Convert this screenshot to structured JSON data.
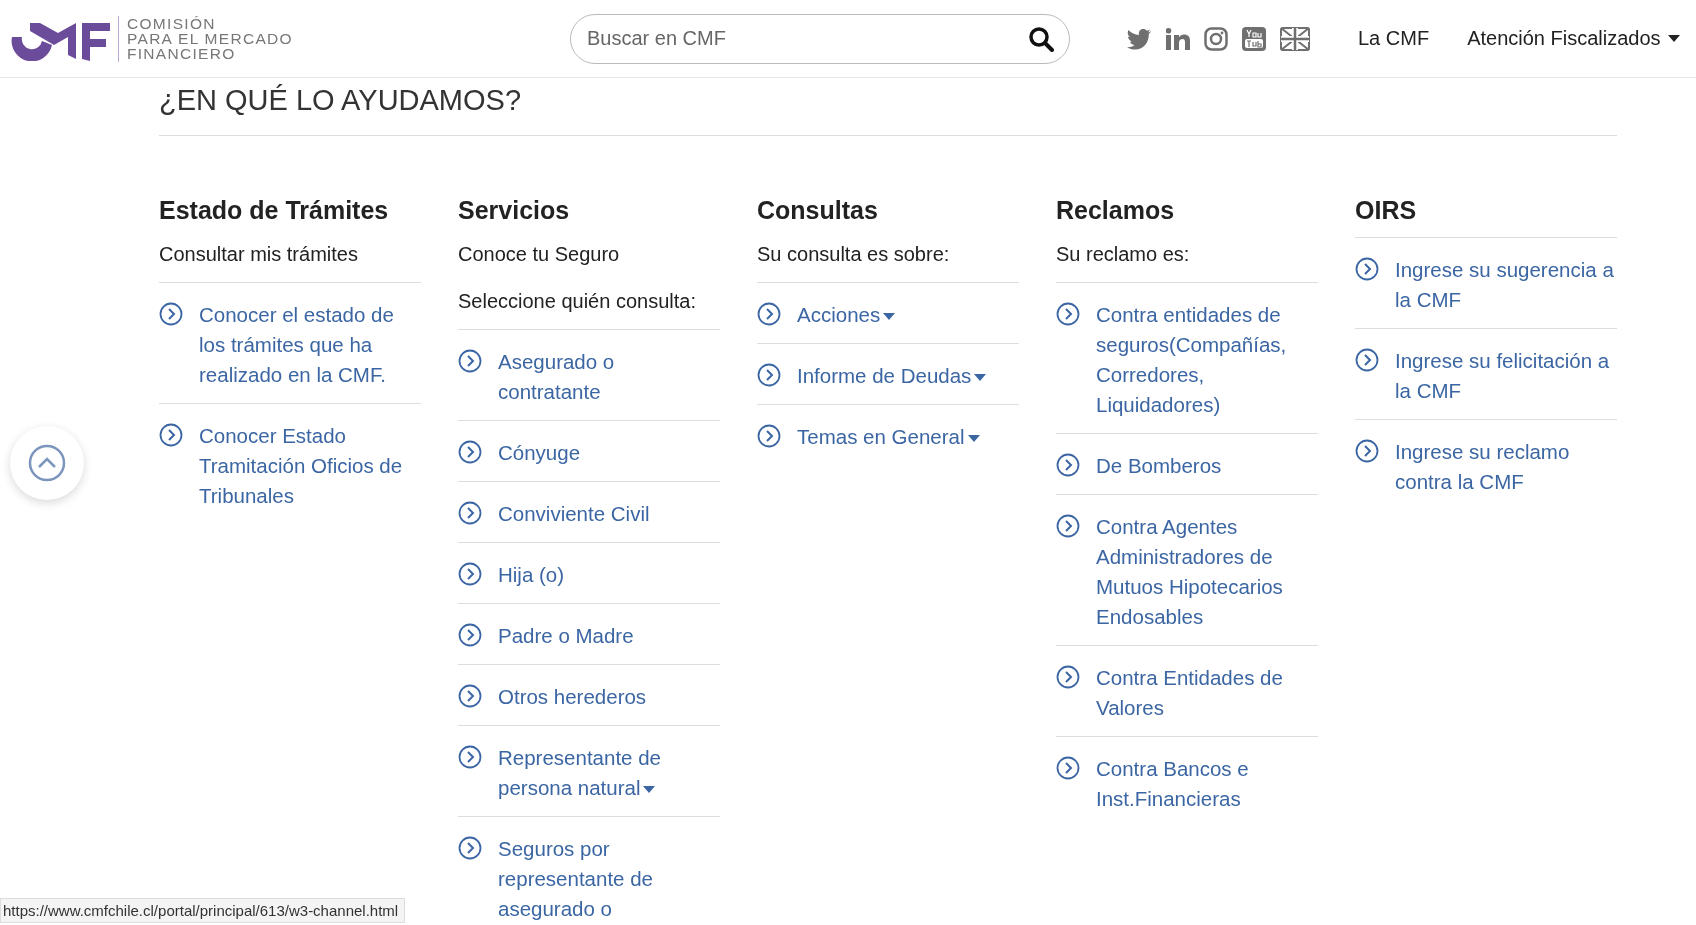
{
  "header": {
    "logo_text": [
      "COMISIÓN",
      "PARA EL MERCADO",
      "FINANCIERO"
    ],
    "search": {
      "placeholder": "Buscar en CMF"
    },
    "nav": [
      {
        "label": "La CMF",
        "dropdown": false
      },
      {
        "label": "Atención Fiscalizados",
        "dropdown": true
      }
    ]
  },
  "title": "¿EN QUÉ LO AYUDAMOS?",
  "columns": [
    {
      "title": "Estado de Trámites",
      "subtitles": [
        "Consultar mis trámites"
      ],
      "links": [
        {
          "label": "Conocer el estado de los trámites que ha realizado en la CMF.",
          "dropdown": false
        },
        {
          "label": "Conocer Estado Tramitación Oficios de Tribunales",
          "dropdown": false
        }
      ]
    },
    {
      "title": "Servicios",
      "subtitles": [
        "Conoce tu Seguro",
        "Seleccione quién consulta:"
      ],
      "links": [
        {
          "label": "Asegurado o contratante",
          "dropdown": false
        },
        {
          "label": "Cónyuge",
          "dropdown": false
        },
        {
          "label": "Conviviente Civil",
          "dropdown": false
        },
        {
          "label": "Hija (o)",
          "dropdown": false
        },
        {
          "label": "Padre o Madre",
          "dropdown": false
        },
        {
          "label": "Otros herederos",
          "dropdown": false
        },
        {
          "label": "Representante de persona natural",
          "dropdown": true
        },
        {
          "label": "Seguros por representante de asegurado o",
          "dropdown": false
        }
      ]
    },
    {
      "title": "Consultas",
      "subtitles": [
        "Su consulta es sobre:"
      ],
      "links": [
        {
          "label": "Acciones",
          "dropdown": true
        },
        {
          "label": "Informe de Deudas",
          "dropdown": true
        },
        {
          "label": "Temas en General",
          "dropdown": true
        }
      ]
    },
    {
      "title": "Reclamos",
      "subtitles": [
        "Su reclamo es:"
      ],
      "links": [
        {
          "label": "Contra entidades de seguros(Compañías, Corredores, Liquidadores)",
          "dropdown": false
        },
        {
          "label": "De Bomberos",
          "dropdown": false
        },
        {
          "label": "Contra Agentes Administradores de Mutuos Hipotecarios Endosables",
          "dropdown": false
        },
        {
          "label": "Contra Entidades de Valores",
          "dropdown": false
        },
        {
          "label": "Contra Bancos e Inst.Financieras",
          "dropdown": false
        }
      ]
    },
    {
      "title": "OIRS",
      "links": [
        {
          "label": "Ingrese su sugerencia a la CMF",
          "dropdown": false
        },
        {
          "label": "Ingrese su felicitación a la CMF",
          "dropdown": false
        },
        {
          "label": "Ingrese su reclamo contra la CMF",
          "dropdown": false
        }
      ]
    }
  ],
  "status_url": "https://www.cmfchile.cl/portal/principal/613/w3-channel.html"
}
